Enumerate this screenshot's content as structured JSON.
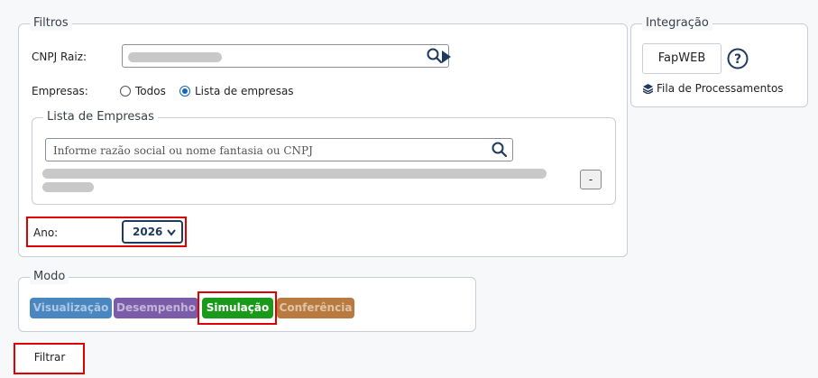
{
  "filters": {
    "legend": "Filtros",
    "cnpj_label": "CNPJ Raiz:",
    "empresas_label": "Empresas:",
    "radio_todos": "Todos",
    "radio_lista": "Lista de empresas",
    "lista_legend": "Lista de Empresas",
    "lista_placeholder": "Informe razão social ou nome fantasia ou CNPJ",
    "remove_label": "-",
    "ano_label": "Ano:",
    "ano_value": "2026"
  },
  "integration": {
    "legend": "Integração",
    "fapweb_label": "FapWEB",
    "help_label": "?",
    "queue_label": "Fila de Processamentos"
  },
  "mode": {
    "legend": "Modo",
    "buttons": [
      {
        "label": "Visualização",
        "color": "#4a86c0"
      },
      {
        "label": "Desempenho",
        "color": "#7a5ca8"
      },
      {
        "label": "Simulação",
        "color": "#1a9a1a"
      },
      {
        "label": "Conferência",
        "color": "#b87a3e"
      }
    ]
  },
  "filter_button": "Filtrar",
  "colors": {
    "highlight": "#e00000",
    "accent": "#1565c0",
    "navy": "#1e3a5f"
  }
}
